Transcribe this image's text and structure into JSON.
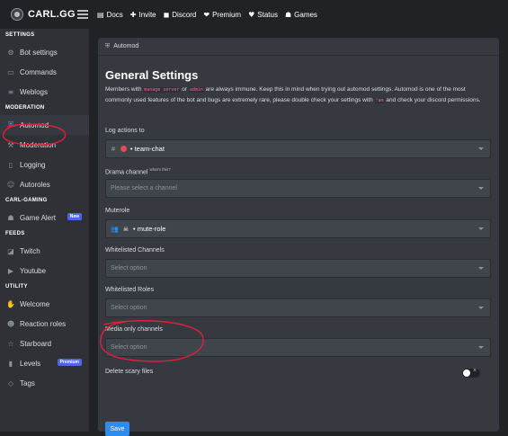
{
  "brand": {
    "name": "CARL.GG"
  },
  "nav": [
    {
      "label": "Docs",
      "icon": "docs-icon",
      "glyph": "▤"
    },
    {
      "label": "Invite",
      "icon": "plus-icon",
      "glyph": "✚"
    },
    {
      "label": "Discord",
      "icon": "discord-icon",
      "glyph": "◼"
    },
    {
      "label": "Premium",
      "icon": "premium-icon",
      "glyph": "❤"
    },
    {
      "label": "Status",
      "icon": "heart-icon",
      "glyph": "♥"
    },
    {
      "label": "Games",
      "icon": "gamepad-icon",
      "glyph": "☗"
    }
  ],
  "sidebar": {
    "sections": {
      "settings": "SETTINGS",
      "moderation": "MODERATION",
      "carl_gaming": "CARL-GAMING",
      "feeds": "FEEDS",
      "utility": "UTILITY"
    },
    "items": {
      "bot_settings": "Bot settings",
      "commands": "Commands",
      "weblogs": "Weblogs",
      "automod": "Automod",
      "moderation": "Moderation",
      "logging": "Logging",
      "autoroles": "Autoroles",
      "game_alert": "Game Alert",
      "twitch": "Twitch",
      "youtube": "Youtube",
      "welcome": "Welcome",
      "reaction_roles": "Reaction roles",
      "starboard": "Starboard",
      "levels": "Levels",
      "tags": "Tags"
    },
    "badges": {
      "game_alert": "New",
      "levels": "Premium"
    }
  },
  "panel": {
    "breadcrumb": "Automod",
    "title": "General Settings",
    "desc_before": "Members with ",
    "perm1": "manage server",
    "desc_or": " or ",
    "perm2": "admin",
    "desc_mid": " are always immune. Keep this in mind when trying out automod settings. Automod is one of the most commonly used features of the bot and bugs are extremely rare, please double check your settings with ",
    "cmd": "!am",
    "desc_after": " and check your discord permissions.",
    "log_actions_label": "Log actions to",
    "log_actions_value": "• team-chat",
    "drama_label": "Drama channel",
    "drama_hint": "what's this?",
    "drama_placeholder": "Please select a channel",
    "muterole_label": "Muterole",
    "muterole_value": "• mute-role",
    "whitelisted_channels_label": "Whitelisted Channels",
    "whitelisted_channels_placeholder": "Select option",
    "whitelisted_roles_label": "Whitelisted Roles",
    "whitelisted_roles_placeholder": "Select option",
    "media_label": "Media only channels",
    "media_placeholder": "Select option",
    "scary_label": "Delete scary files",
    "toggle_x": "×",
    "save_label": "Save"
  },
  "colors": {
    "accent": "#2d8cf0",
    "annotation": "#e0203a",
    "badge": "#4f66e6"
  }
}
